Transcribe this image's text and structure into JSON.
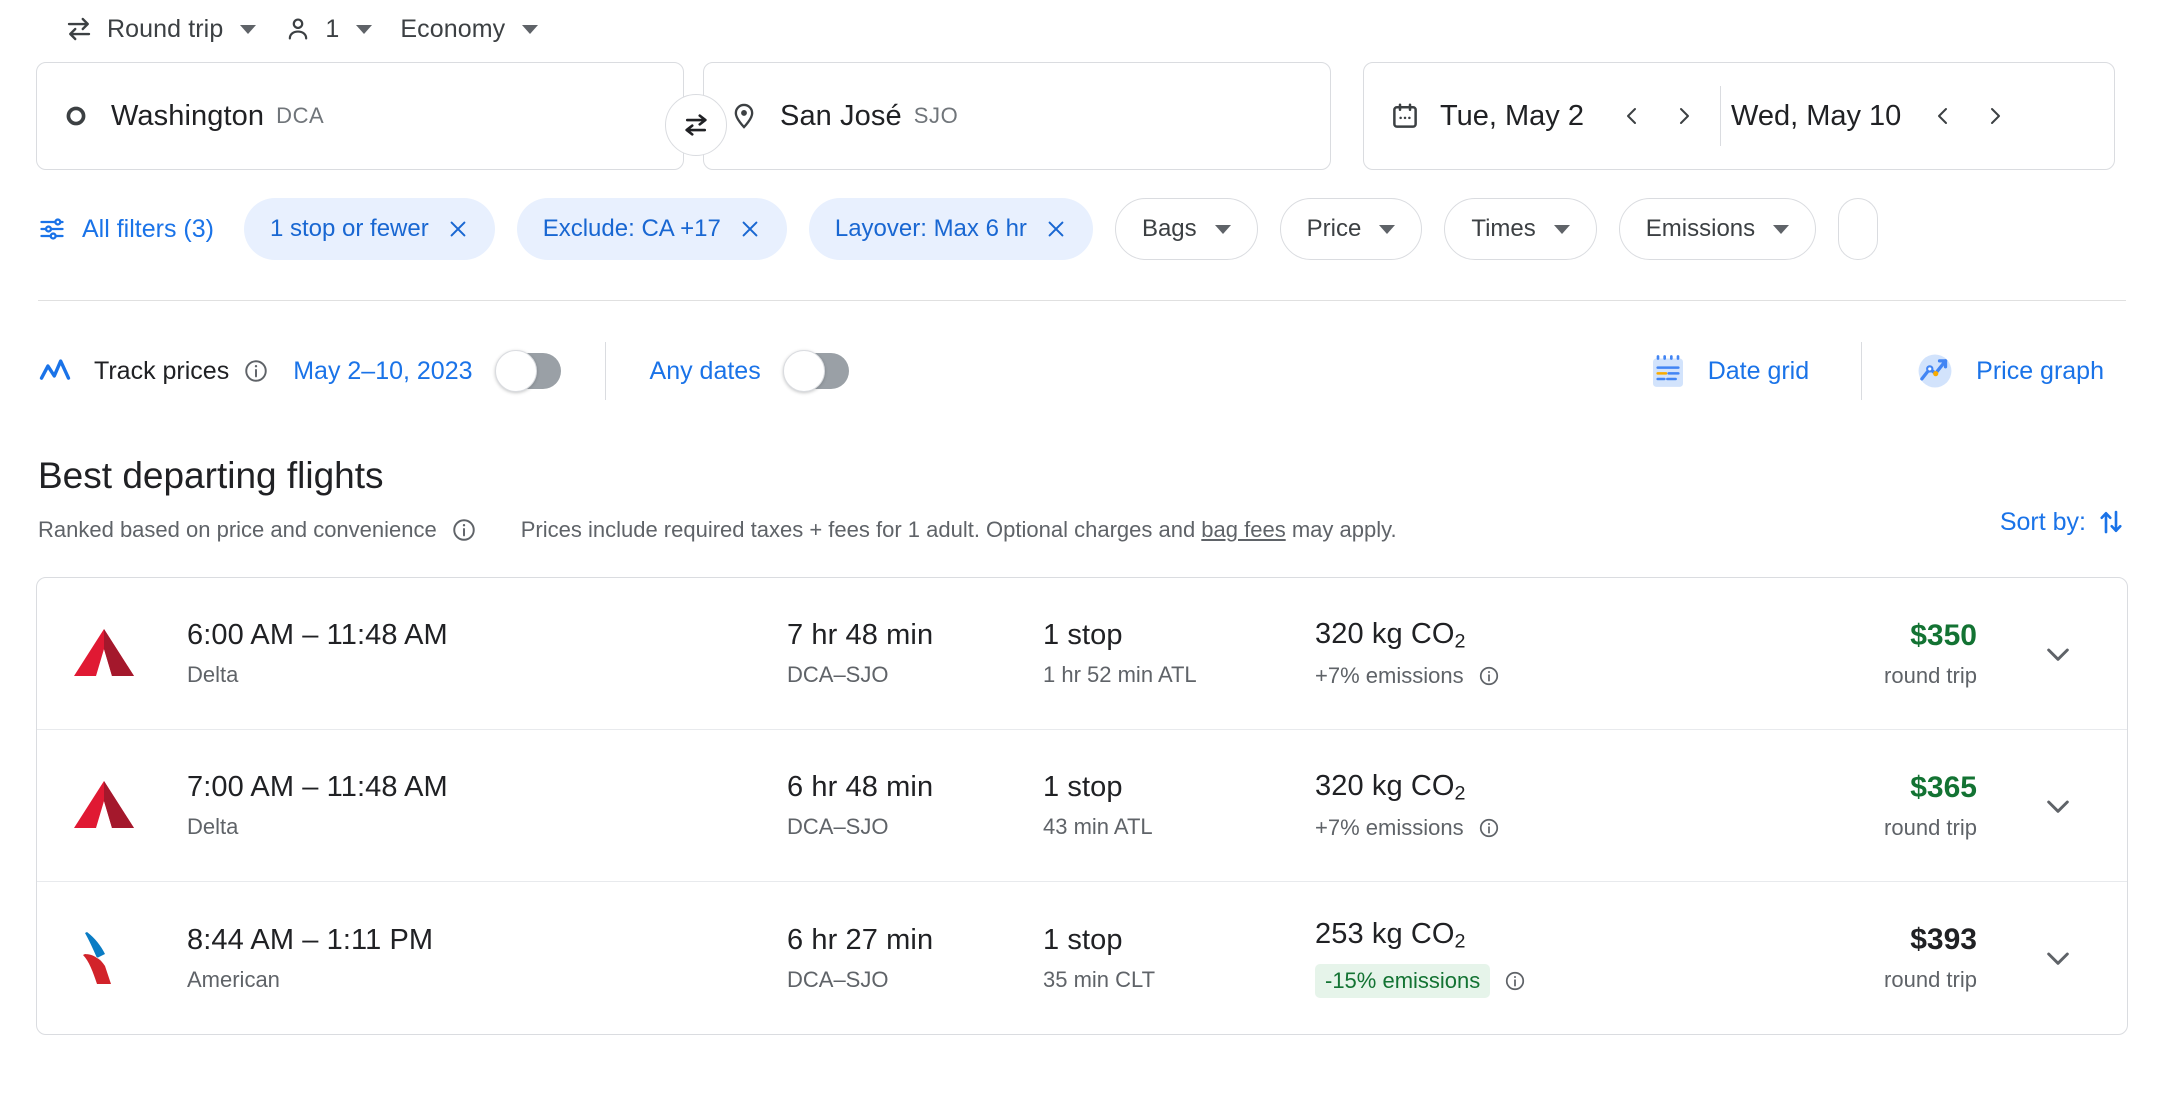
{
  "trip_options": {
    "trip_type": {
      "label": "Round trip",
      "icon": "swap-horizontal-icon"
    },
    "passengers": {
      "label": "1",
      "icon": "person-icon"
    },
    "cabin_class": {
      "label": "Economy"
    }
  },
  "search": {
    "origin": {
      "city": "Washington",
      "code": "DCA",
      "icon": "circle-outline-icon"
    },
    "destination": {
      "city": "San José",
      "code": "SJO",
      "icon": "location-pin-icon"
    },
    "swap_icon": "swap-arrows-icon",
    "depart_date": "Tue, May 2",
    "return_date": "Wed, May 10",
    "calendar_icon": "calendar-icon"
  },
  "filters": {
    "all_filters_label": "All filters (3)",
    "all_filters_icon": "tune-icon",
    "chips": [
      {
        "label": "1 stop or fewer",
        "active": true,
        "removable": true
      },
      {
        "label": "Exclude: CA +17",
        "active": true,
        "removable": true
      },
      {
        "label": "Layover: Max 6 hr",
        "active": true,
        "removable": true
      },
      {
        "label": "Bags",
        "active": false,
        "removable": false
      },
      {
        "label": "Price",
        "active": false,
        "removable": false
      },
      {
        "label": "Times",
        "active": false,
        "removable": false
      },
      {
        "label": "Emissions",
        "active": false,
        "removable": false
      }
    ]
  },
  "track_prices": {
    "label": "Track prices",
    "icon": "trending-up-icon",
    "info_icon": "info-icon",
    "date_range": "May 2–10, 2023",
    "date_range_toggle_on": false,
    "any_dates_label": "Any dates",
    "any_dates_toggle_on": false,
    "date_grid_label": "Date grid",
    "date_grid_icon": "calendar-grid-icon",
    "price_graph_label": "Price graph",
    "price_graph_icon": "price-graph-icon"
  },
  "results": {
    "title": "Best departing flights",
    "ranked_note": "Ranked based on price and convenience",
    "ranked_info_icon": "info-icon",
    "price_note_prefix": "Prices include required taxes + fees for 1 adult. Optional charges and ",
    "price_note_link": "bag fees",
    "price_note_suffix": " may apply.",
    "sort_by_label": "Sort by:",
    "sort_by_icon": "sort-arrows-icon",
    "flights": [
      {
        "airline": "Delta",
        "logo": "delta-logo",
        "times": "6:00 AM – 11:48 AM",
        "duration": "7 hr 48 min",
        "route": "DCA–SJO",
        "stops": "1 stop",
        "layover": "1 hr 52 min ATL",
        "emissions": "320 kg CO",
        "emissions_sub": "2",
        "emissions_delta": "+7% emissions",
        "emissions_highlight": false,
        "price": "$350",
        "price_is_deal": true,
        "price_note": "round trip",
        "expand_icon": "chevron-down-icon"
      },
      {
        "airline": "Delta",
        "logo": "delta-logo",
        "times": "7:00 AM – 11:48 AM",
        "duration": "6 hr 48 min",
        "route": "DCA–SJO",
        "stops": "1 stop",
        "layover": "43 min ATL",
        "emissions": "320 kg CO",
        "emissions_sub": "2",
        "emissions_delta": "+7% emissions",
        "emissions_highlight": false,
        "price": "$365",
        "price_is_deal": true,
        "price_note": "round trip",
        "expand_icon": "chevron-down-icon"
      },
      {
        "airline": "American",
        "logo": "american-logo",
        "times": "8:44 AM – 1:11 PM",
        "duration": "6 hr 27 min",
        "route": "DCA–SJO",
        "stops": "1 stop",
        "layover": "35 min CLT",
        "emissions": "253 kg CO",
        "emissions_sub": "2",
        "emissions_delta": "-15% emissions",
        "emissions_highlight": true,
        "price": "$393",
        "price_is_deal": false,
        "price_note": "round trip",
        "expand_icon": "chevron-down-icon"
      }
    ]
  },
  "colors": {
    "accent_blue": "#1a73e8",
    "chip_active_bg": "#e8f0fe",
    "chip_active_text": "#1967d2",
    "price_green": "#137333",
    "badge_bg": "#e6f4ea"
  }
}
